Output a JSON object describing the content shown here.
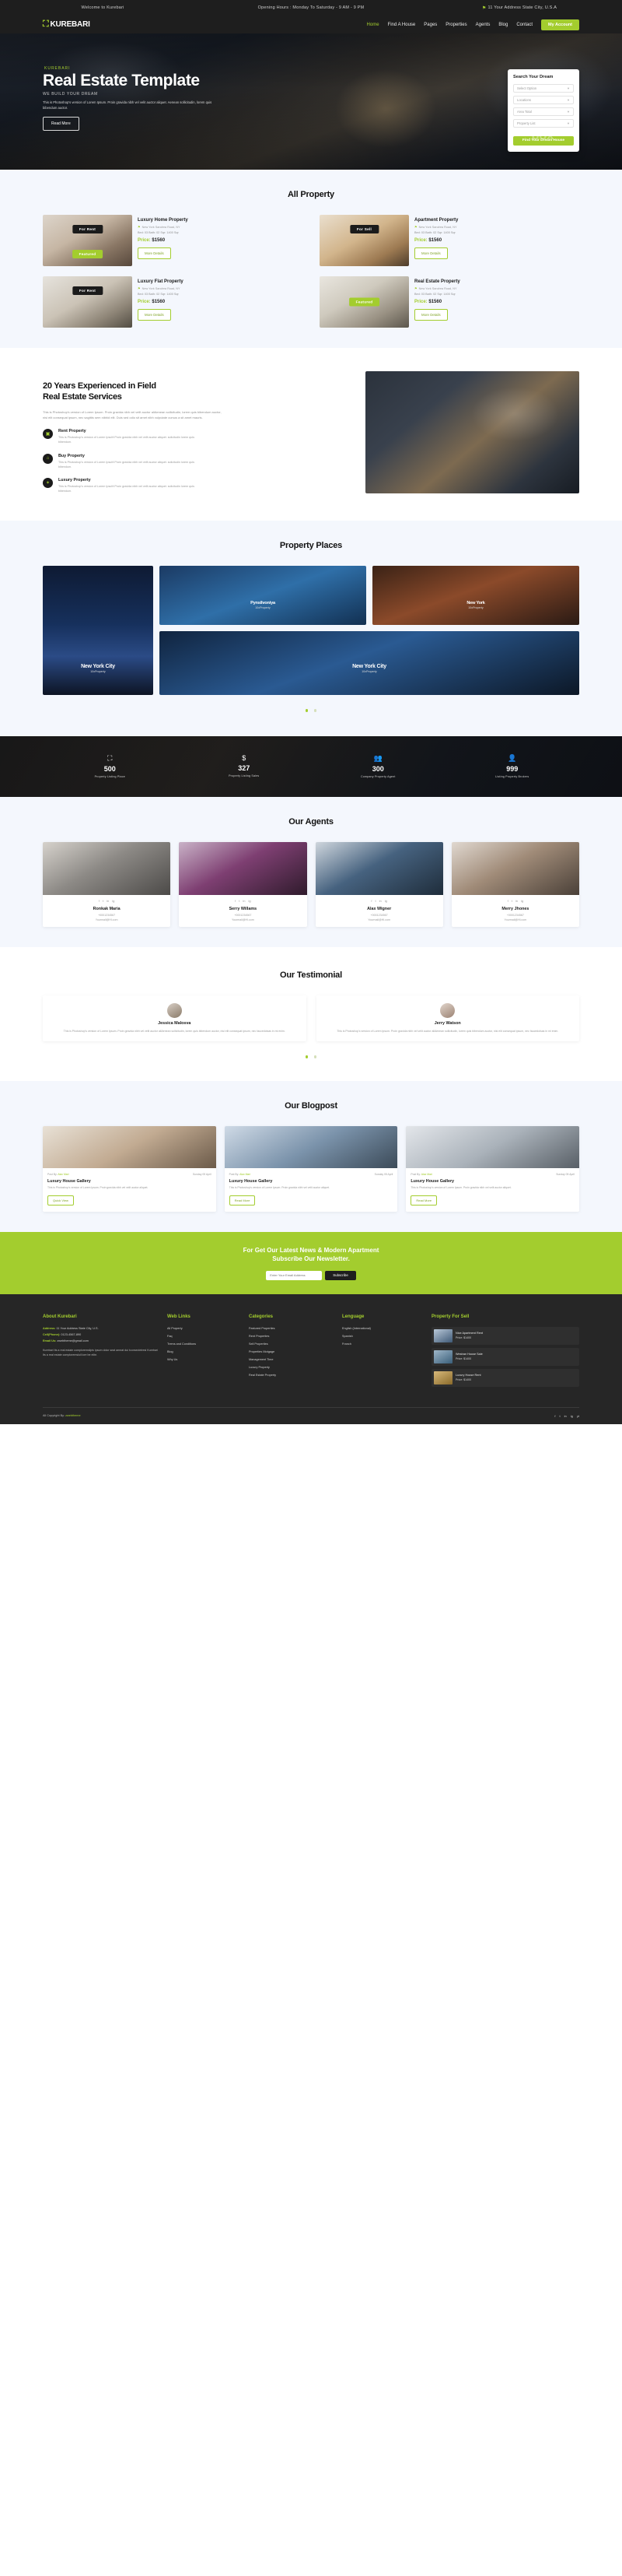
{
  "topbar": {
    "welcome": "Welcome to Kurebari",
    "hours": "Opening Hours : Monday To Saturday - 9 AM - 9 PM",
    "address": "11 Your Address State City, U.S.A",
    "pin_icon": "location-pin-icon"
  },
  "nav": {
    "logo_mark": "building-icon",
    "logo": "KUREBARI",
    "items": [
      {
        "label": "Home",
        "active": true
      },
      {
        "label": "Find A House",
        "active": false
      },
      {
        "label": "Pages",
        "active": false
      },
      {
        "label": "Properties",
        "active": false
      },
      {
        "label": "Agents",
        "active": false
      },
      {
        "label": "Blog",
        "active": false
      },
      {
        "label": "Contact",
        "active": false
      }
    ],
    "cta": "My Account"
  },
  "hero": {
    "eyebrow": "KUREBARI",
    "title": "Real Estate Template",
    "subtitle": "WE BUILD YOUR DREAM",
    "desc": "This is Photoshop's version of Lorem Ipsum. Proin gravida nibh vel velit auctor aliquet. Aenean sollicitudin, lorem quis bibendum auctor.",
    "button": "Read More",
    "watermark": "box",
    "search": {
      "title": "Search Your Dream",
      "fields": [
        {
          "value": "Select Option",
          "chev": "chevron-down-icon"
        },
        {
          "value": "Locations",
          "chev": "chevron-down-icon"
        },
        {
          "value": "Area Total",
          "chev": "chevron-down-icon"
        },
        {
          "value": "Property List",
          "chev": "chevron-down-icon"
        }
      ],
      "button": "Find Your Dream House"
    }
  },
  "all_property": {
    "title": "All Property",
    "cards": [
      {
        "tag": "For Rent",
        "badge": "Featured",
        "badge_pos": "bottom",
        "thumb": "thumb-a",
        "name": "Luxury Home Property",
        "location": "New York Sandrea Road, NY",
        "meta": "Bed: 03   Bath: 02   Sqr: 1400 Sqr",
        "price_label": "Price:",
        "price": "$1560",
        "button": "More Details"
      },
      {
        "tag": "For Sell",
        "badge": "",
        "badge_pos": "",
        "thumb": "thumb-b",
        "name": "Apartment Property",
        "location": "New York Sandrea Road, NY",
        "meta": "Bed: 03   Bath: 02   Sqr: 1400 Sqr",
        "price_label": "Price:",
        "price": "$1560",
        "button": "More Details"
      },
      {
        "tag": "For Rent",
        "badge": "",
        "badge_pos": "",
        "thumb": "thumb-c",
        "name": "Luxury Flat Property",
        "location": "New York Sandrea Road, NY",
        "meta": "Bed: 03   Bath: 02   Sqr: 1400 Sqr",
        "price_label": "Price:",
        "price": "$1560",
        "button": "More Details"
      },
      {
        "tag": "",
        "badge": "Featured",
        "badge_pos": "mid",
        "thumb": "thumb-d",
        "name": "Real Estate Property",
        "location": "New York Sandrea Road, NY",
        "meta": "Bed: 03   Bath: 02   Sqr: 1400 Sqr",
        "price_label": "Price:",
        "price": "$1560",
        "button": "More Details"
      }
    ]
  },
  "about": {
    "heading_l1": "20 Years Experienced in Field",
    "heading_l2": "Real Estate Services",
    "paragraph": "This is Photoshop's version of Lorem Ipsum. Proin gravida nibh vel velit auctor aliAenean sollicitudin, lorem quis bibendum auctor, nisi elit consequat ipsum, nec sagittis sem nibhid elit. Duis sed odio sit amet nibh vulputate cursus a sit amet mauris.",
    "features": [
      {
        "icon": "monitor-icon",
        "glyph": "▣",
        "title": "Rent Property",
        "desc": "This is Photoshop's version of Lorem IpsuM Proin gravida nibh vel velit auctor aliquet. solicitudin lorem quis bibendum."
      },
      {
        "icon": "home-icon",
        "glyph": "⌂",
        "title": "Buy Property",
        "desc": "This is Photoshop's version of Lorem IpsuM Proin gravida nibh vel velit auctor aliquet. solicitudin lorem quis bibendum."
      },
      {
        "icon": "star-icon",
        "glyph": "✶",
        "title": "Luxury Property",
        "desc": "This is Photoshop's version of Lorem IpsuM Proin gravida nibh vel velit auctor aliquet. solicitudin lorem quis bibendum."
      }
    ]
  },
  "places": {
    "title": "Property Places",
    "big": {
      "name": "New York City",
      "sub": "10xProperty"
    },
    "a": {
      "name": "Pynsilvoniya",
      "sub": "10xProperty"
    },
    "b": {
      "name": "New York",
      "sub": "10xProperty"
    },
    "c": {
      "name": "New York City",
      "sub": "10xProperty"
    },
    "dots": 2
  },
  "stats": [
    {
      "icon": "building-icon",
      "glyph": "🏢",
      "number": "500",
      "label": "Property Listing Place"
    },
    {
      "icon": "dollar-icon",
      "glyph": "$",
      "number": "327",
      "label": "Property Listing Sales"
    },
    {
      "icon": "users-icon",
      "glyph": "👥",
      "number": "300",
      "label": "Company Property Agent"
    },
    {
      "icon": "agent-icon",
      "glyph": "👤",
      "number": "999",
      "label": "Listing Property Brokers"
    }
  ],
  "agents": {
    "title": "Our Agents",
    "social_icons": [
      "facebook-icon",
      "twitter-icon",
      "linkedin-icon",
      "instagram-icon"
    ],
    "social_glyphs": [
      "f",
      "t",
      "in",
      "ig"
    ],
    "items": [
      {
        "img": "ag1",
        "name": "Ronkak Maria",
        "phone": "+0001234567",
        "mail": "Yourmail@Hl.com"
      },
      {
        "img": "ag2",
        "name": "Serry Willams",
        "phone": "+0001234567",
        "mail": "Yourmail@Hl.com"
      },
      {
        "img": "ag3",
        "name": "Alax Wigner",
        "phone": "+0001234567",
        "mail": "Yourmail@Hl.com"
      },
      {
        "img": "ag4",
        "name": "Merry Jhones",
        "phone": "+0001234567",
        "mail": "Yourmail@Hl.com"
      }
    ]
  },
  "testimonial": {
    "title": "Our Testimonial",
    "items": [
      {
        "av": "av1",
        "name": "Jessica Malosva",
        "text": "This is Photoshop's version of Lorem Ipsum. Proin gravida nibh vel velit auctor aliAenean sollicitudin, lorem quis bibendum auctor, nisi elit consequat ipsum, nec faucedolsas in mi enim."
      },
      {
        "av": "av2",
        "name": "Jerry Watson",
        "text": "This is Photoshop's version of Lorem Ipsum. Proin gravida nibh vel velit auctor aliAenean sollicitudin, lorem quis bibendum auctor, nisi elit consequat ipsum, nec faucedolsas in mi enim."
      }
    ],
    "dots": 2
  },
  "blog": {
    "title": "Our Blogpost",
    "items": [
      {
        "img": "bg1",
        "by_label": "Post By:",
        "by": "Alax Mari",
        "date": "Sunday 05 April",
        "title": "Luxury House Gallery",
        "desc": "This is Photoshop's version of Lorem Ipsum. Proin gravida nibh vel velit auctor aliquet.",
        "button": "Quick View"
      },
      {
        "img": "bg2",
        "by_label": "Post By:",
        "by": "Alax Mari",
        "date": "Sunday 05 April",
        "title": "Luxury House Gallery",
        "desc": "This is Photoshop's version of Lorem Ipsum. Proin gravida nibh vel velit auctor aliquet.",
        "button": "Read More"
      },
      {
        "img": "bg3",
        "by_label": "Post By:",
        "by": "Alax Mari",
        "date": "Sunday 05 April",
        "title": "Luxury House Gallery",
        "desc": "This is Photoshop's version of Lorem Ipsum. Proin gravida nibh vel velit auctor aliquet.",
        "button": "Read More"
      }
    ]
  },
  "newsletter": {
    "line1": "For Get Our Latest News & Modern Apartment",
    "line2": "Subscribe Our Newsletter.",
    "placeholder": "Enter Your Email Address",
    "button": "Subscribe"
  },
  "footer": {
    "about": {
      "title": "About Kurebari",
      "address_label": "Address:",
      "address": "11 Your Address State City, U.S.",
      "phone_label": "Cell(Phone):",
      "phone": "0123-4567-890",
      "email_label": "Email Us:",
      "email": "zwebtheme@gmail.com",
      "desc": "Kurebari Its a real estate comploremsiipis ipsum dolor seat ameat dui tconsectetresi Kurebari Its a real estate comploremsluil lore be elite."
    },
    "weblinks": {
      "title": "Web Links",
      "items": [
        "All Property",
        "Faq",
        "Trems and Conditions",
        "Blog",
        "Why Us"
      ]
    },
    "categories": {
      "title": "Categories",
      "items": [
        "Featured Properties",
        "Rent Properties",
        "Sell Properties",
        "Properties Motgage",
        "Management Time",
        "Luxury Property",
        "Real Estate Property"
      ]
    },
    "language": {
      "title": "Lenguage",
      "items": [
        "English (International)",
        "Spanish",
        "Franch"
      ]
    },
    "forsell": {
      "title": "Property For Sell",
      "items": [
        {
          "img": "fpi1",
          "title": "Nice Apartment Rent",
          "price": "Price: $1400"
        },
        {
          "img": "fpi2",
          "title": "Westran House Sale",
          "price": "Price: $1400"
        },
        {
          "img": "fpi3",
          "title": "Luxury House Rent",
          "price": "Price: $1400"
        }
      ]
    },
    "copyright": "All Copyright By:",
    "copyright_brand": "zwebtheme",
    "social_icons": [
      "facebook-icon",
      "twitter-icon",
      "linkedin-icon",
      "instagram-icon",
      "youtube-icon"
    ],
    "social_glyphs": [
      "f",
      "t",
      "in",
      "ig",
      "yt"
    ]
  },
  "colors": {
    "accent": "#a3cd2e",
    "dark": "#1e1e1e",
    "footer": "#262626",
    "light_section": "#f4f7fd"
  }
}
